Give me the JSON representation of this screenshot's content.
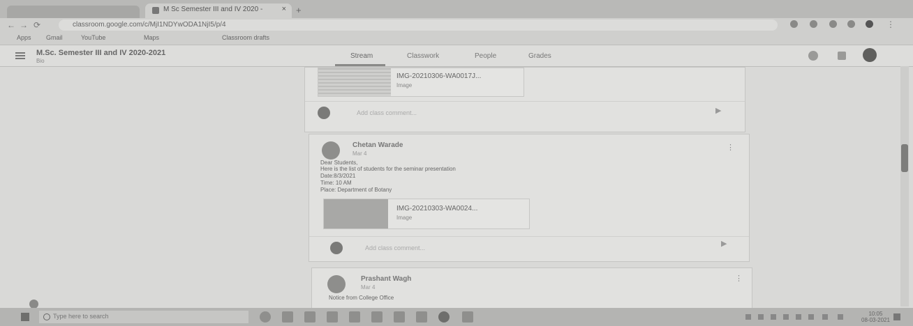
{
  "browser": {
    "tabs": [
      {
        "title": "",
        "active": false
      },
      {
        "title": "M Sc Semester III and IV 2020 -",
        "active": true
      }
    ],
    "new_tab_glyph": "+",
    "close_glyph": "×",
    "nav": {
      "back": "←",
      "forward": "→",
      "reload": "⟳"
    },
    "url": "classroom.google.com/c/MjI1NDYwODA1NjI5/p/4",
    "bookmarks": [
      "Apps",
      "Gmail",
      "YouTube",
      "Maps",
      "Classroom drafts"
    ]
  },
  "classroom": {
    "class_title": "M.Sc. Semester III and IV 2020-2021",
    "class_subtitle": "Bio",
    "tabs": [
      "Stream",
      "Classwork",
      "People",
      "Grades"
    ],
    "active_tab": "Stream",
    "icons": [
      "apps-grid-icon",
      "settings-icon",
      "account-avatar-icon"
    ]
  },
  "stream": {
    "posts": [
      {
        "attachment": {
          "name": "IMG-20210306-WA0017J...",
          "type": "Image"
        },
        "comment_placeholder": "Add class comment..."
      },
      {
        "author": "Chetan Warade",
        "date": "Mar 4",
        "body": [
          "Dear Students,",
          "Here is the list of students for the seminar presentation",
          "Date:8/3/2021",
          "Time: 10 AM",
          "Place: Department of Botany"
        ],
        "attachment": {
          "name": "IMG-20210303-WA0024...",
          "type": "Image"
        },
        "comment_placeholder": "Add class comment..."
      },
      {
        "author": "Prashant Wagh",
        "date": "Mar 4",
        "body": [
          "Notice from College Office"
        ]
      }
    ],
    "send_glyph": "▶",
    "more_glyph": "⋮"
  },
  "taskbar": {
    "search_placeholder": "Type here to search",
    "time": "10:05",
    "date": "08-03-2021"
  }
}
